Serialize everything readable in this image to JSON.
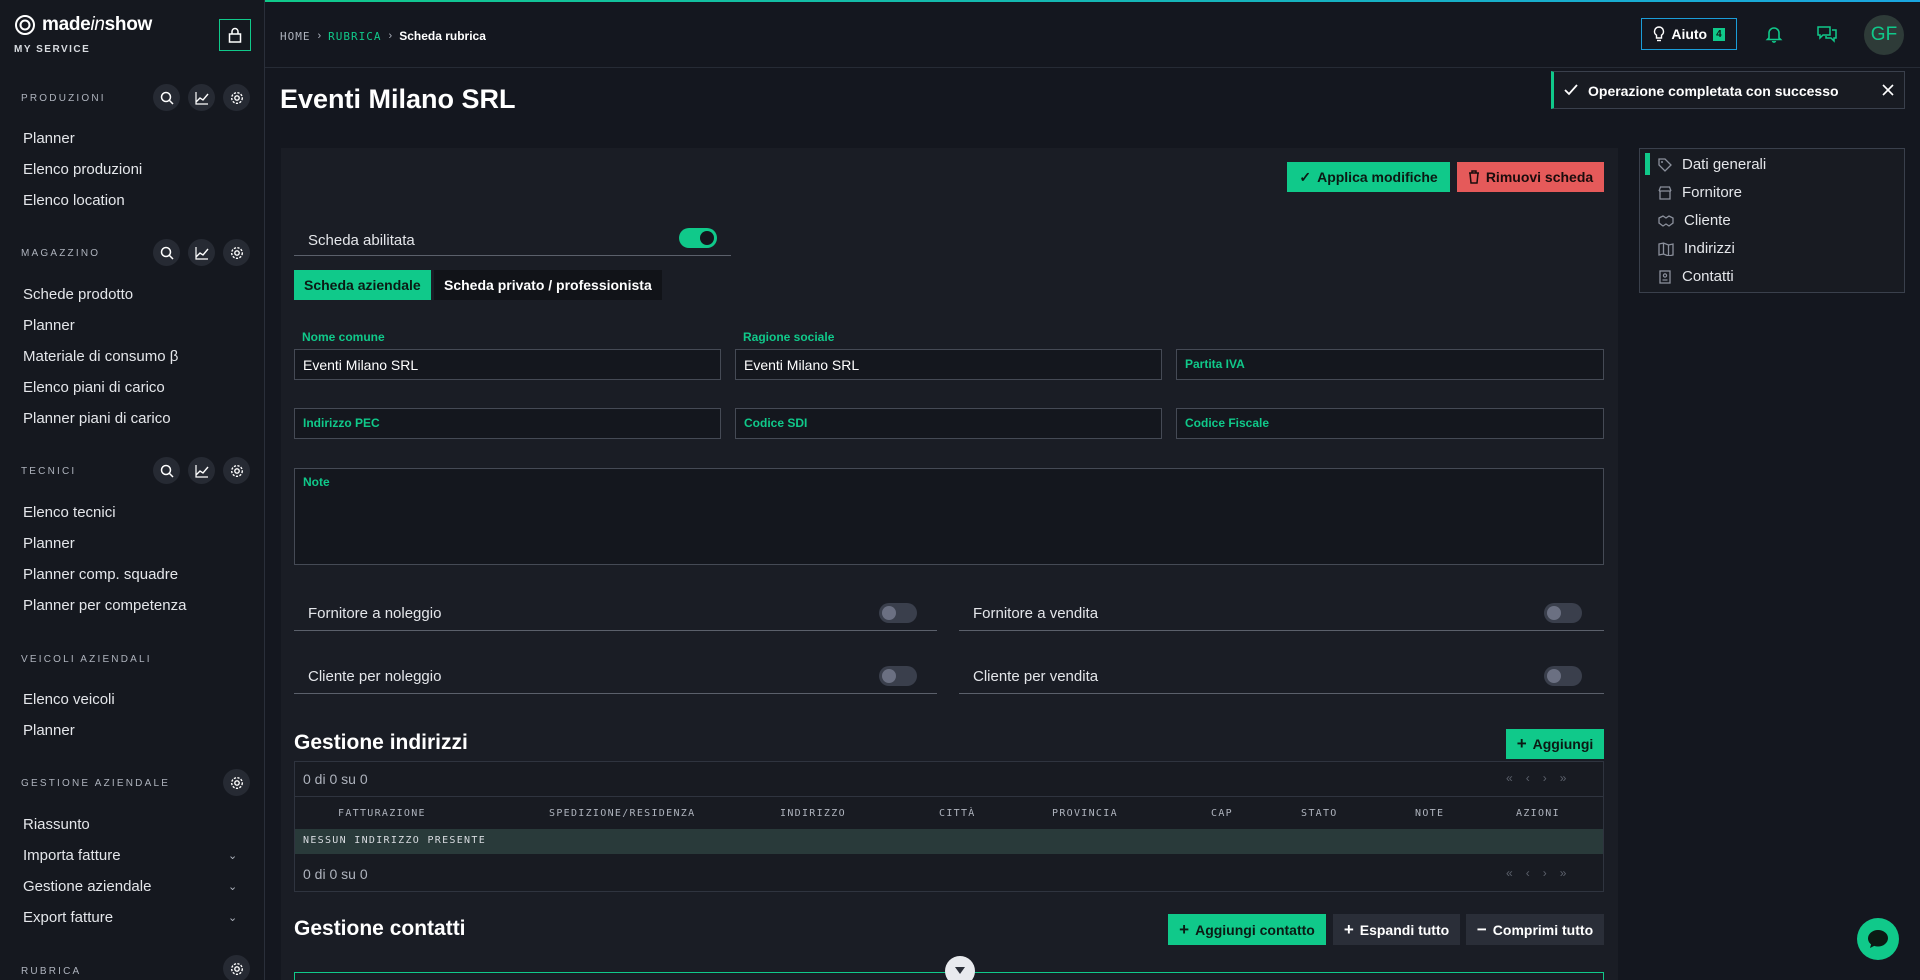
{
  "brand": {
    "logo_text_a": "made",
    "logo_text_b": "in",
    "logo_text_c": "show",
    "subtitle": "MY SERVICE"
  },
  "sidebar": {
    "sections": [
      {
        "title": "PRODUZIONI",
        "items": [
          "Planner",
          "Elenco produzioni",
          "Elenco location"
        ]
      },
      {
        "title": "MAGAZZINO",
        "items": [
          "Schede prodotto",
          "Planner",
          "Materiale di consumo β",
          "Elenco piani di carico",
          "Planner piani di carico"
        ]
      },
      {
        "title": "TECNICI",
        "items": [
          "Elenco tecnici",
          "Planner",
          "Planner comp. squadre",
          "Planner per competenza"
        ]
      },
      {
        "title": "VEICOLI AZIENDALI",
        "items": [
          "Elenco veicoli",
          "Planner"
        ]
      },
      {
        "title": "GESTIONE AZIENDALE",
        "items": [
          "Riassunto",
          "Importa fatture",
          "Gestione aziendale",
          "Export fatture"
        ]
      },
      {
        "title": "RUBRICA",
        "items": []
      }
    ]
  },
  "breadcrumb": {
    "home": "HOME",
    "section": "RUBRICA",
    "current": "Scheda rubrica"
  },
  "header": {
    "help_label": "Aiuto",
    "help_count": "4",
    "avatar_initials": "GF"
  },
  "page": {
    "title": "Eventi Milano SRL"
  },
  "actions": {
    "apply": "Applica modifiche",
    "remove": "Rimuovi scheda"
  },
  "form": {
    "enabled_label": "Scheda abilitata",
    "tabs": [
      "Scheda aziendale",
      "Scheda privato / professionista"
    ],
    "fields": {
      "nome_comune": {
        "label": "Nome comune",
        "value": "Eventi Milano SRL"
      },
      "ragione_sociale": {
        "label": "Ragione sociale",
        "value": "Eventi Milano SRL"
      },
      "partita_iva": {
        "label": "Partita IVA",
        "value": ""
      },
      "pec": {
        "label": "Indirizzo PEC",
        "value": ""
      },
      "sdi": {
        "label": "Codice SDI",
        "value": ""
      },
      "cf": {
        "label": "Codice Fiscale",
        "value": ""
      },
      "note": {
        "label": "Note",
        "value": ""
      }
    },
    "toggles": {
      "fornitore_noleggio": "Fornitore a noleggio",
      "fornitore_vendita": "Fornitore a vendita",
      "cliente_noleggio": "Cliente per noleggio",
      "cliente_vendita": "Cliente per vendita"
    }
  },
  "addresses": {
    "title": "Gestione indirizzi",
    "add_label": "Aggiungi",
    "pager_text": "0 di 0 su 0",
    "columns": [
      "FATTURAZIONE",
      "SPEDIZIONE/RESIDENZA",
      "INDIRIZZO",
      "CITTÀ",
      "PROVINCIA",
      "CAP",
      "STATO",
      "NOTE",
      "AZIONI"
    ],
    "empty_text": "NESSUN INDIRIZZO PRESENTE"
  },
  "contacts": {
    "title": "Gestione contatti",
    "add_label": "Aggiungi contatto",
    "expand_label": "Espandi tutto",
    "collapse_label": "Comprimi tutto"
  },
  "toast": {
    "text": "Operazione completata con successo"
  },
  "anchors": {
    "items": [
      "Dati generali",
      "Fornitore",
      "Cliente",
      "Indirizzi",
      "Contatti"
    ]
  }
}
